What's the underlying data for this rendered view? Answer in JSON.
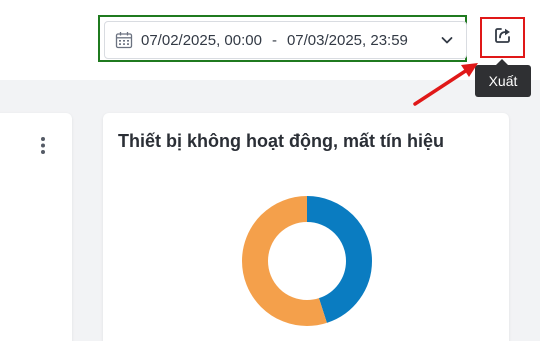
{
  "date_range": {
    "start": "07/02/2025, 00:00",
    "separator": "-",
    "end": "07/03/2025, 23:59",
    "icon": "calendar-icon",
    "dropdown_icon": "chevron-down-icon"
  },
  "export": {
    "icon": "export-share-icon",
    "tooltip": "Xuất"
  },
  "cards": {
    "right_title": "Thiết bị không hoạt động, mất tín hiệu",
    "left_menu_icon": "kebab-menu-icon"
  },
  "donut": {
    "segments": [
      {
        "color": "#0a7cc1",
        "fraction": 0.45
      },
      {
        "color": "#f4a04b",
        "fraction": 0.55
      }
    ]
  },
  "colors": {
    "highlight_green": "#1f7a1f",
    "highlight_red": "#e01818",
    "tooltip_bg": "#2f3033",
    "page_bg": "#f2f3f5"
  }
}
